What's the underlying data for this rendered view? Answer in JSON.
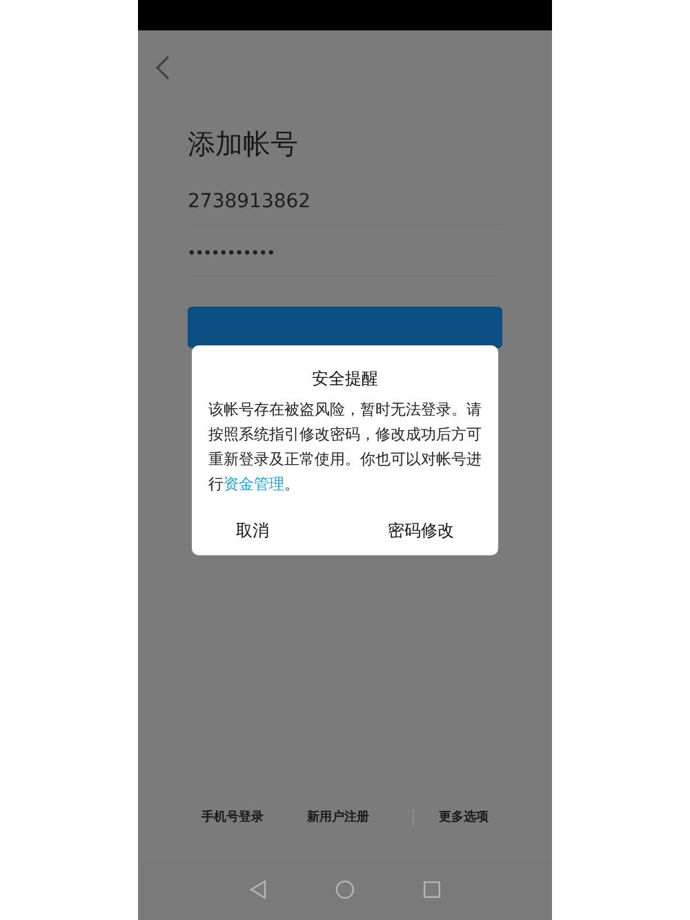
{
  "header": {
    "title": "添加帐号"
  },
  "form": {
    "account": "2738913862",
    "password": "•••••••••••"
  },
  "dialog": {
    "title": "安全提醒",
    "message": "该帐号存在被盗风险，暂时无法登录。请按照系统指引修改密码，修改成功后方可重新登录及正常使用。你也可以对帐号进行",
    "link": "资金管理",
    "message_end": "。",
    "buttons": [
      "取消",
      "密码修改"
    ]
  },
  "footer_links": [
    "手机号登录",
    "新用户注册",
    "更多选项"
  ]
}
